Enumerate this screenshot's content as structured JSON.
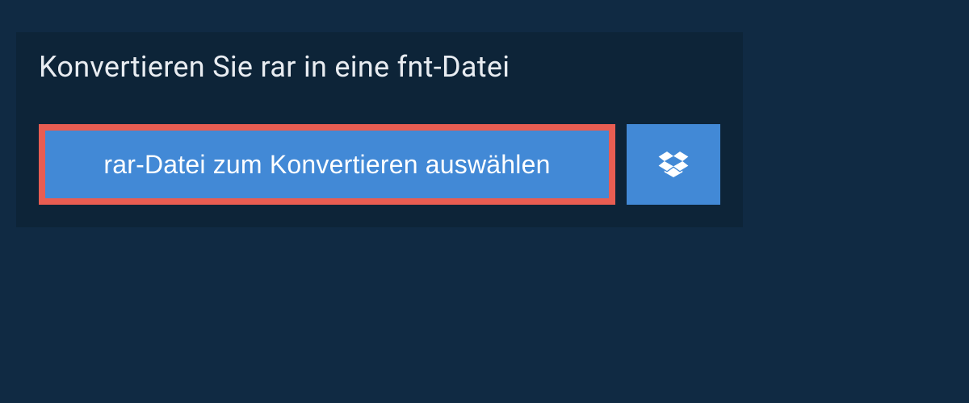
{
  "header": {
    "title": "Konvertieren Sie rar in eine fnt-Datei"
  },
  "buttons": {
    "select_file_label": "rar-Datei zum Konvertieren auswählen"
  },
  "colors": {
    "page_bg": "#102a43",
    "panel_bg": "#0d2438",
    "button_bg": "#4289d6",
    "highlight_border": "#e85d52",
    "text_light": "#e8ecf1"
  }
}
